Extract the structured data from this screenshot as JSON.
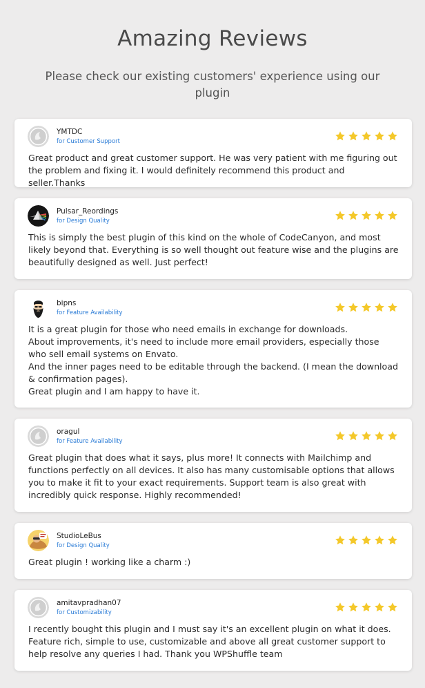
{
  "header": {
    "title": "Amazing Reviews",
    "subtitle": "Please check our existing customers' experience using our plugin"
  },
  "colors": {
    "star": "#f4c82a",
    "category": "#2a7bd6",
    "background": "#edecec"
  },
  "reviews": [
    {
      "author": "YMTDC",
      "category": "for Customer Support",
      "avatar": "default-avatar-icon",
      "rating": 5,
      "lines": [
        "Great product and great customer support. He was very patient with me figuring out the problem and fixing it. I would definitely recommend this product and seller.Thanks"
      ]
    },
    {
      "author": "Pulsar_Reordings",
      "category": "for Design Quality",
      "avatar": "prism-avatar-icon",
      "rating": 5,
      "lines": [
        "This is simply the best plugin of this kind on the whole of CodeCanyon, and most likely beyond that. Everything is so well thought out feature wise and the plugins are beautifully designed as well. Just perfect!"
      ]
    },
    {
      "author": "bipns",
      "category": "for Feature Availability",
      "avatar": "bearded-man-avatar-icon",
      "rating": 5,
      "lines": [
        "It is a great plugin for those who need emails in exchange for downloads.",
        "About improvements, it's need to include more email providers, especially those who sell email systems on Envato.",
        "And the inner pages need to be editable through the backend. (I mean the download & confirmation pages).",
        "Great plugin and I am happy to have it."
      ]
    },
    {
      "author": "oragul",
      "category": "for Feature Availability",
      "avatar": "default-avatar-icon",
      "rating": 5,
      "lines": [
        "Great plugin that does what it says, plus more! It connects with Mailchimp and functions perfectly on all devices. It also has many customisable options that allows you to make it fit to your exact requirements. Support team is also great with incredibly quick response. Highly recommended!"
      ]
    },
    {
      "author": "StudioLeBus",
      "category": "for Design Quality",
      "avatar": "studio-avatar-icon",
      "rating": 5,
      "lines": [
        "Great plugin ! working like a charm :)"
      ]
    },
    {
      "author": "amitavpradhan07",
      "category": "for Customizability",
      "avatar": "default-avatar-icon",
      "rating": 5,
      "lines": [
        "I recently bought this plugin and I must say it's an excellent plugin on what it does. Feature rich, simple to use, customizable and above all great customer support to help resolve any queries I had. Thank you WPShuffle team"
      ]
    }
  ]
}
